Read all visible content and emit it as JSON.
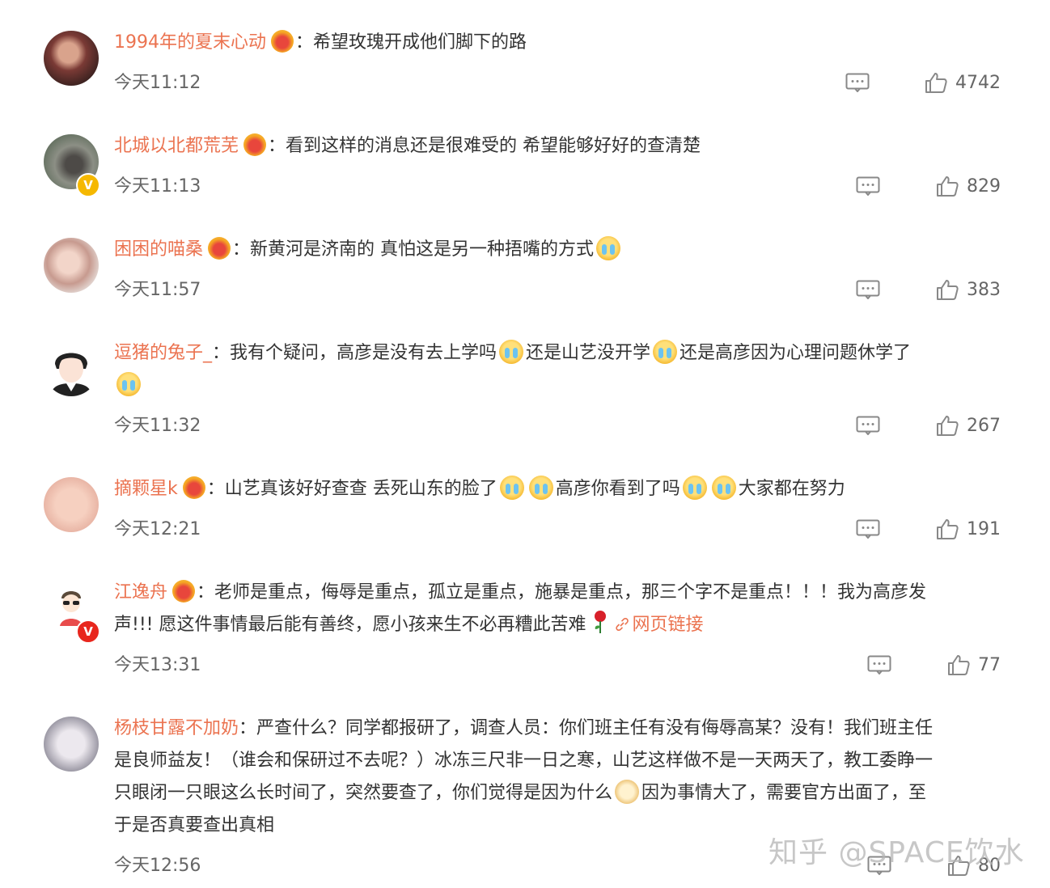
{
  "comments": [
    {
      "username": "1994年的夏末心动",
      "text": "：希望玫瑰开成他们脚下的路",
      "time": "今天11:12",
      "likes": "4742"
    },
    {
      "username": "北城以北都荒芜",
      "text": "：看到这样的消息还是很难受的 希望能够好好的查清楚",
      "time": "今天11:13",
      "likes": "829"
    },
    {
      "username": "困困的喵桑",
      "text": "：新黄河是济南的 真怕这是另一种捂嘴的方式",
      "time": "今天11:57",
      "likes": "383"
    },
    {
      "username": "逗猪的兔子_",
      "text_parts": [
        "：我有个疑问，高彦是没有去上学吗",
        "还是山艺没开学",
        "还是高彦因为心理问题休学了"
      ],
      "time": "今天11:32",
      "likes": "267"
    },
    {
      "username": "摘颗星k",
      "text_parts": [
        "：山艺真该好好查查 丢死山东的脸了",
        "高彦你看到了吗",
        "大家都在努力"
      ],
      "time": "今天12:21",
      "likes": "191"
    },
    {
      "username": "江逸舟",
      "text_line1": "：老师是重点，侮辱是重点，孤立是重点，施暴是重点，那三个字不是重点！！！我为高彦发",
      "text_line2": "声!!! 愿这件事情最后能有善终，愿小孩来生不必再糟此苦难",
      "link": "网页链接",
      "time": "今天13:31",
      "likes": "77"
    },
    {
      "username": "杨枝甘露不加奶",
      "text_line1": "：严查什么？同学都报研了，调查人员：你们班主任有没有侮辱高某？没有！我们班主任",
      "text_line2": "是良师益友！（谁会和保研过不去呢？）冰冻三尺非一日之寒，山艺这样做不是一天两天了，教工委睁一",
      "text_line3a": "只眼闭一只眼这么长时间了，突然要查了，你们觉得是因为什么",
      "text_line3b": "因为事情大了，需要官方出面了，至",
      "text_line4": "于是否真要查出真相",
      "time": "今天12:56",
      "likes": "80"
    }
  ],
  "watermark": "知乎 @SPACE饮水",
  "colors": {
    "username": "#eb7350",
    "text": "#333333",
    "meta": "#666666"
  }
}
